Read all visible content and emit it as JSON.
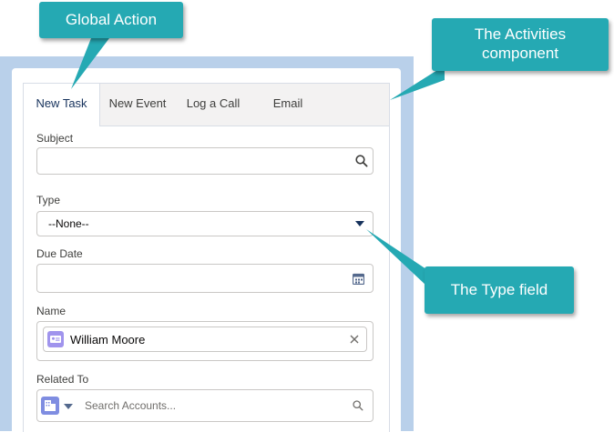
{
  "tabs": [
    {
      "label": "New Task",
      "active": true
    },
    {
      "label": "New Event"
    },
    {
      "label": "Log a Call"
    },
    {
      "label": "Email"
    }
  ],
  "form": {
    "subject_label": "Subject",
    "type_label": "Type",
    "type_value": "--None--",
    "due_date_label": "Due Date",
    "name_label": "Name",
    "name_value": "William Moore",
    "related_label": "Related To",
    "related_placeholder": "Search Accounts..."
  },
  "callouts": {
    "global_action": "Global Action",
    "activities_line1": "The Activities",
    "activities_line2": "component",
    "type_field": "The Type field"
  },
  "colors": {
    "callout": "#25a9b3",
    "background_panel": "#b9d0ea",
    "active_tab_text": "#16325c",
    "contact_icon": "#a094ed",
    "account_icon": "#7f8de1"
  }
}
